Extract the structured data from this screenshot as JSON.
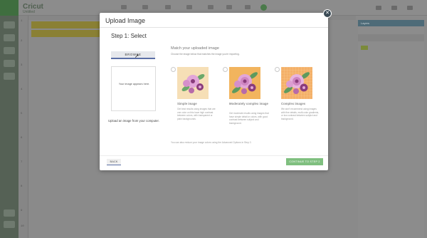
{
  "app": {
    "brand": "Cricut",
    "brand_sub": "Untitled",
    "ruler_ticks": [
      "1",
      "2",
      "3",
      "4",
      "5",
      "6",
      "7",
      "8",
      "9",
      "10",
      "11"
    ],
    "right_panel_title": "Layers"
  },
  "modal": {
    "title": "Upload Image",
    "close_icon": "close-icon",
    "step_title": "Step 1: Select",
    "browse_label": "BROWSE",
    "preview_text": "Your image appears here.",
    "upload_caption": "Upload an image from your computer.",
    "match_title": "Match your uploaded image",
    "match_desc": "Choose the image below that matches the image you're importing.",
    "options": [
      {
        "title": "Simple image",
        "desc": "Get best results using images that are one color on this have high contrast between colors, with transparent or plain backgrounds.",
        "thumb_bg": "#f6dfb6"
      },
      {
        "title": "Moderately complex image",
        "desc": "Get moderate results using images that have simple detail or colors, with good contrast between subject and background.",
        "thumb_bg": "#f2b45e"
      },
      {
        "title": "Complex images",
        "desc": "We don't recommend using images with fine details, multi-color gradients, or low contrast between subject and background.",
        "thumb_bg": "#f4b068"
      }
    ],
    "advanced_note": "You can also reduce your image colors using the Advanced Options in Step 2.",
    "back_label": "BACK",
    "continue_label": "CONTINUE TO STEP 2"
  },
  "colors": {
    "accent_blue": "#5b6fa6",
    "continue_green": "#7fbf7f",
    "flower_pink": "#e2a6d8",
    "flower_purple": "#8a3c7c",
    "leaf_green": "#6aa86a"
  }
}
